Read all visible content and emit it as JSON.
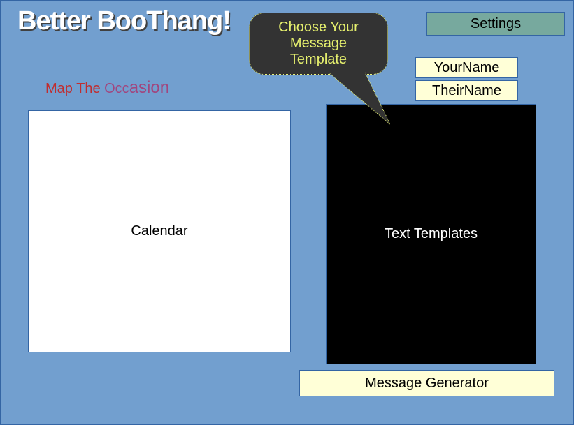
{
  "app": {
    "title": "Better BooThang!"
  },
  "header": {
    "settings_label": "Settings"
  },
  "callout": {
    "line1": "Choose Your",
    "line2": "Message",
    "line3": "Template"
  },
  "fields": {
    "your_name": "YourName",
    "their_name": "TheirName"
  },
  "occasion": {
    "label_part1": "Map The ",
    "label_part2": "Occ",
    "label_part3": "asion"
  },
  "panels": {
    "calendar_label": "Calendar",
    "templates_label": "Text Templates"
  },
  "footer": {
    "generator_label": "Message Generator"
  },
  "colors": {
    "background": "#729fcf",
    "border": "#3465a4",
    "settings_bg": "#77a99e",
    "field_bg": "#ffffd7",
    "callout_bg": "#333333",
    "callout_text": "#e6f06e",
    "occasion_red": "#c9211e",
    "occasion_purple": "#a1467e"
  }
}
